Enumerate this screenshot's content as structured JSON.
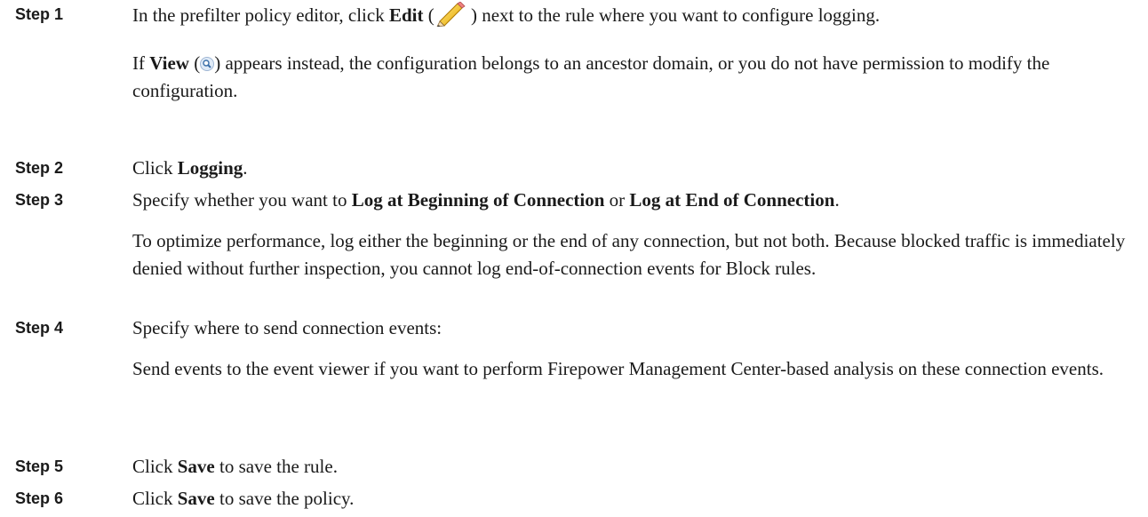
{
  "steps": [
    {
      "label": "Step 1",
      "main": {
        "pre": "In the prefilter policy editor, click ",
        "bold": "Edit",
        "open_paren": " (",
        "icon": "edit-pencil-icon",
        "close_paren": " )",
        "post": " next to the rule where you want to configure logging."
      },
      "note": {
        "pre": "If ",
        "bold": "View",
        "open_paren": " (",
        "icon": "view-magnifier-icon",
        "post": ") appears instead, the configuration belongs to an ancestor domain, or you do not have permission to modify the configuration."
      }
    },
    {
      "label": "Step 2",
      "main": {
        "pre": "Click ",
        "bold": "Logging",
        "post": "."
      }
    },
    {
      "label": "Step 3",
      "main": {
        "pre": "Specify whether you want to ",
        "bold1": "Log at Beginning of Connection",
        "mid": " or ",
        "bold2": "Log at End of Connection",
        "post": "."
      },
      "note": "To optimize performance, log either the beginning or the end of any connection, but not both. Because blocked traffic is immediately denied without further inspection, you cannot log end-of-connection events for Block rules."
    },
    {
      "label": "Step 4",
      "main": "Specify where to send connection events:",
      "note": "Send events to the event viewer if you want to perform Firepower Management Center-based analysis on these connection events."
    },
    {
      "label": "Step 5",
      "main": {
        "pre": "Click ",
        "bold": "Save",
        "post": " to save the rule."
      }
    },
    {
      "label": "Step 6",
      "main": {
        "pre": "Click ",
        "bold": "Save",
        "post": " to save the policy."
      }
    }
  ]
}
